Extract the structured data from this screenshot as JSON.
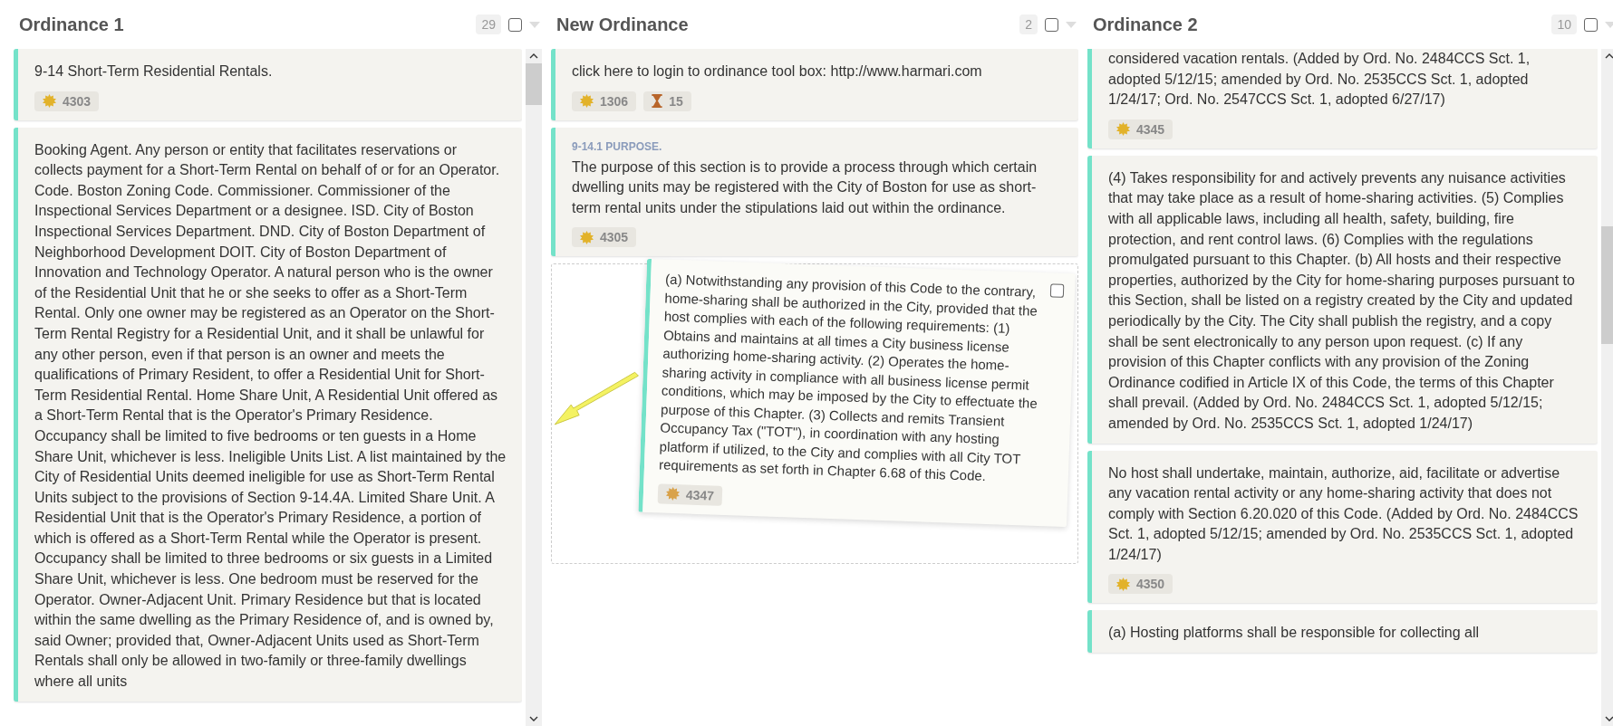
{
  "columns": [
    {
      "title": "Ordinance 1",
      "count": "29",
      "checked": false,
      "scrollable": true,
      "drop_placeholder": false,
      "cards": [
        {
          "text": "9-14 Short-Term Residential Rentals.",
          "badges": [
            {
              "kind": "points",
              "value": "4303"
            }
          ]
        },
        {
          "text": "Booking Agent. Any person or entity that facilitates reservations or collects payment for a Short-Term Rental on behalf of or for an Operator. Code. Boston Zoning Code. Commissioner. Commissioner of the Inspectional Services Department or a designee. ISD. City of Boston Inspectional Services Department. DND. City of Boston Department of Neighborhood Development DOIT. City of Boston Department of Innovation and Technology Operator. A natural person who is the owner of the Residential Unit that he or she seeks to offer as a Short-Term Rental. Only one owner may be registered as an Operator on the Short-Term Rental Registry for a Residential Unit, and it shall be unlawful for any other person, even if that person is an owner and meets the qualifications of Primary Resident, to offer a Residential Unit for Short-Term Residential Rental. Home Share Unit, A Residential Unit offered as a Short-Term Rental that is the Operator's Primary Residence. Occupancy shall be limited to five bedrooms or ten guests in a Home Share Unit, whichever is less. Ineligible Units List. A list maintained by the City of Residential Units deemed ineligible for use as Short-Term Rental Units subject to the provisions of Section 9-14.4A. Limited Share Unit. A Residential Unit that is the Operator's Primary Residence, a portion of which is offered as a Short-Term Rental while the Operator is present. Occupancy shall be limited to three bedrooms or six guests in a Limited Share Unit, whichever is less. One bedroom must be reserved for the Operator. Owner-Adjacent Unit. Primary Residence but that is located within the same dwelling as the Primary Residence of, and is owned by, said Owner; provided that, Owner-Adjacent Units used as Short-Term Rentals shall only be allowed in two-family or three-family dwellings where all units"
        }
      ]
    },
    {
      "title": "New Ordinance",
      "count": "2",
      "checked": false,
      "scrollable": false,
      "drop_placeholder": true,
      "cards": [
        {
          "text": "click here to login to ordinance tool box: http://www.harmari.com",
          "badges": [
            {
              "kind": "points",
              "value": "1306"
            },
            {
              "kind": "time",
              "value": "15"
            }
          ]
        },
        {
          "label": "9-14.1 PURPOSE.",
          "text": "The purpose of this section is to provide a process through which certain dwelling units may be registered with the City of Boston for use as short-term rental units under the stipulations laid out within the ordinance.",
          "badges": [
            {
              "kind": "points",
              "value": "4305"
            }
          ]
        }
      ]
    },
    {
      "title": "Ordinance 2",
      "count": "10",
      "checked": false,
      "scrollable": true,
      "drop_placeholder": false,
      "cards": [
        {
          "text": "considered vacation rentals. (Added by Ord. No. 2484CCS Sct. 1, adopted 5/12/15; amended by Ord. No. 2535CCS Sct. 1, adopted 1/24/17; Ord. No. 2547CCS Sct. 1, adopted 6/27/17)",
          "badges": [
            {
              "kind": "points",
              "value": "4345"
            }
          ]
        },
        {
          "text": "(4) Takes responsibility for and actively prevents any nuisance activities that may take place as a result of home-sharing activities. (5) Complies with all applicable laws, including all health, safety, building, fire protection, and rent control laws. (6) Complies with the regulations promulgated pursuant to this Chapter. (b) All hosts and their respective properties, authorized by the City for home-sharing purposes pursuant to this Section, shall be listed on a registry created by the City and updated periodically by the City. The City shall publish the registry, and a copy shall be sent electronically to any person upon request. (c) If any provision of this Chapter conflicts with any provision of the Zoning Ordinance codified in Article IX of this Code, the terms of this Chapter shall prevail. (Added by Ord. No. 2484CCS Sct. 1, adopted 5/12/15; amended by Ord. No. 2535CCS Sct. 1, adopted 1/24/17)"
        },
        {
          "text": "No host shall undertake, maintain, authorize, aid, facilitate or advertise any vacation rental activity or any home-sharing activity that does not comply with Section 6.20.020 of this Code. (Added by Ord. No. 2484CCS Sct. 1, adopted 5/12/15; amended by Ord. No. 2535CCS Sct. 1, adopted 1/24/17)",
          "badges": [
            {
              "kind": "points",
              "value": "4350"
            }
          ]
        },
        {
          "text": "(a) Hosting platforms shall be responsible for collecting all"
        }
      ]
    }
  ],
  "dragged_card": {
    "text": "(a) Notwithstanding any provision of this Code to the contrary, home-sharing shall be authorized in the City, provided that the host complies with each of the following requirements: (1) Obtains and maintains at all times a City business license authorizing home-sharing activity. (2) Operates the home-sharing activity in compliance with all business license permit conditions, which may be imposed by the City to effectuate the purpose of this Chapter. (3) Collects and remits Transient Occupancy Tax (\"TOT\"), in coordination with any hosting platform if utilized, to the City and complies with all City TOT requirements as set forth in Chapter 6.68 of this Code.",
    "checked": false,
    "badges": [
      {
        "kind": "points",
        "value": "4347"
      }
    ]
  }
}
